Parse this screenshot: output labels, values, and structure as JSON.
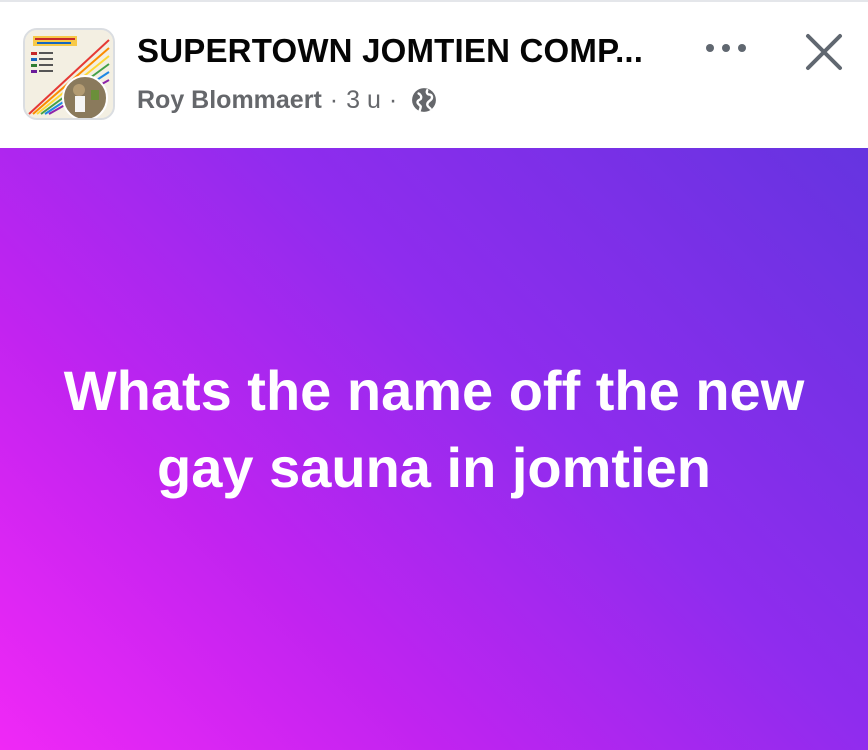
{
  "header": {
    "group_name": "SUPERTOWN JOMTIEN COMP...",
    "author": "Roy Blommaert",
    "separator": "·",
    "time": "3 u",
    "privacy_icon": "globe-icon",
    "more_icon": "more-horizontal-icon",
    "close_icon": "close-icon"
  },
  "post": {
    "text": "Whats the name off the new gay sauna in jomtien",
    "gradient_colors": [
      "#f028f6",
      "#c123f0",
      "#8f2cee",
      "#6534e0"
    ]
  },
  "colors": {
    "title": "#050505",
    "meta": "#65676b",
    "icon": "#606770"
  }
}
